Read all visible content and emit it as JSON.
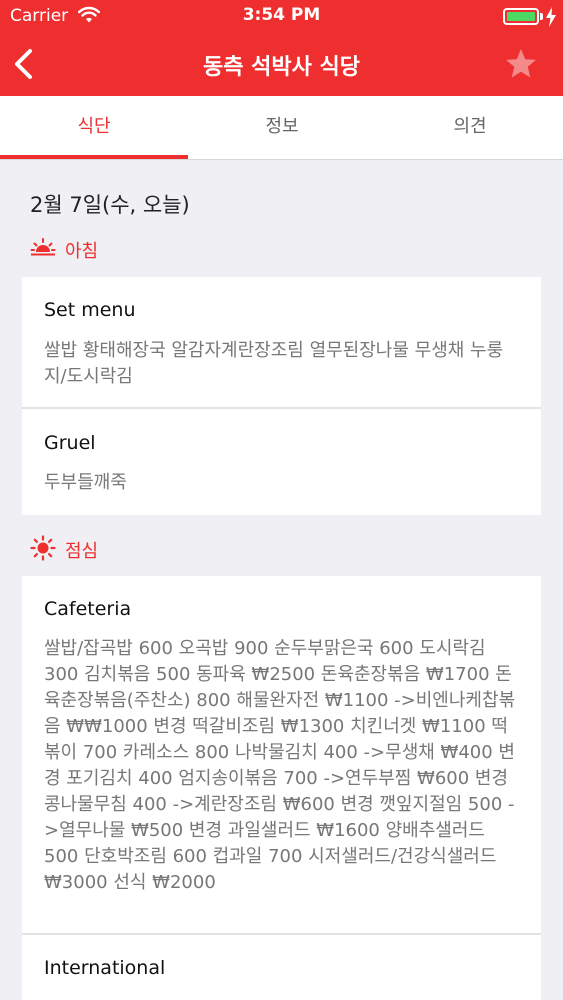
{
  "status_bar": {
    "carrier": "Carrier",
    "time": "3:54 PM",
    "battery_color": "#4cd964"
  },
  "nav": {
    "title": "동측 석박사 식당",
    "back_icon": "chevron-left-icon",
    "favorite_icon": "star-icon",
    "bar_color": "#ef2f2f"
  },
  "tabs": [
    {
      "label": "식단",
      "active": true
    },
    {
      "label": "정보",
      "active": false
    },
    {
      "label": "의견",
      "active": false
    }
  ],
  "date": "2월 7일(수, 오늘)",
  "meals": [
    {
      "name": "아침",
      "icon": "sunrise-icon",
      "items": [
        {
          "name": "Set menu",
          "menu": "쌀밥 황태해장국 알감자계란장조림 열무된장나물 무생채 누룽지/도시락김"
        },
        {
          "name": "Gruel",
          "menu": "두부들깨죽"
        }
      ]
    },
    {
      "name": "점심",
      "icon": "sun-icon",
      "items": [
        {
          "name": "Cafeteria",
          "menu": "쌀밥/잡곡밥 600 오곡밥 900 순두부맑은국 600 도시락김 300 김치볶음 500 동파육 ₩2500 돈육춘장볶음 ₩1700 돈육춘장볶음(주찬소) 800 해물완자전 ₩1100 ->비엔나케찹볶음 ₩₩1000 변경 떡갈비조림 ₩1300 치킨너겟 ₩1100 떡볶이 700 카레소스 800 나박물김치 400 ->무생채 ₩400 변경 포기김치 400 엄지송이볶음 700 ->연두부찜 ₩600 변경 콩나물무침 400 ->계란장조림 ₩600 변경 깻잎지절임 500 ->열무나물 ₩500 변경 과일샐러드 ₩1600 양배추샐러드 500 단호박조림 600 컵과일 700 시저샐러드/건강식샐러드 ₩3000 선식 ₩2000"
        },
        {
          "name": "International",
          "menu": ""
        }
      ]
    }
  ]
}
